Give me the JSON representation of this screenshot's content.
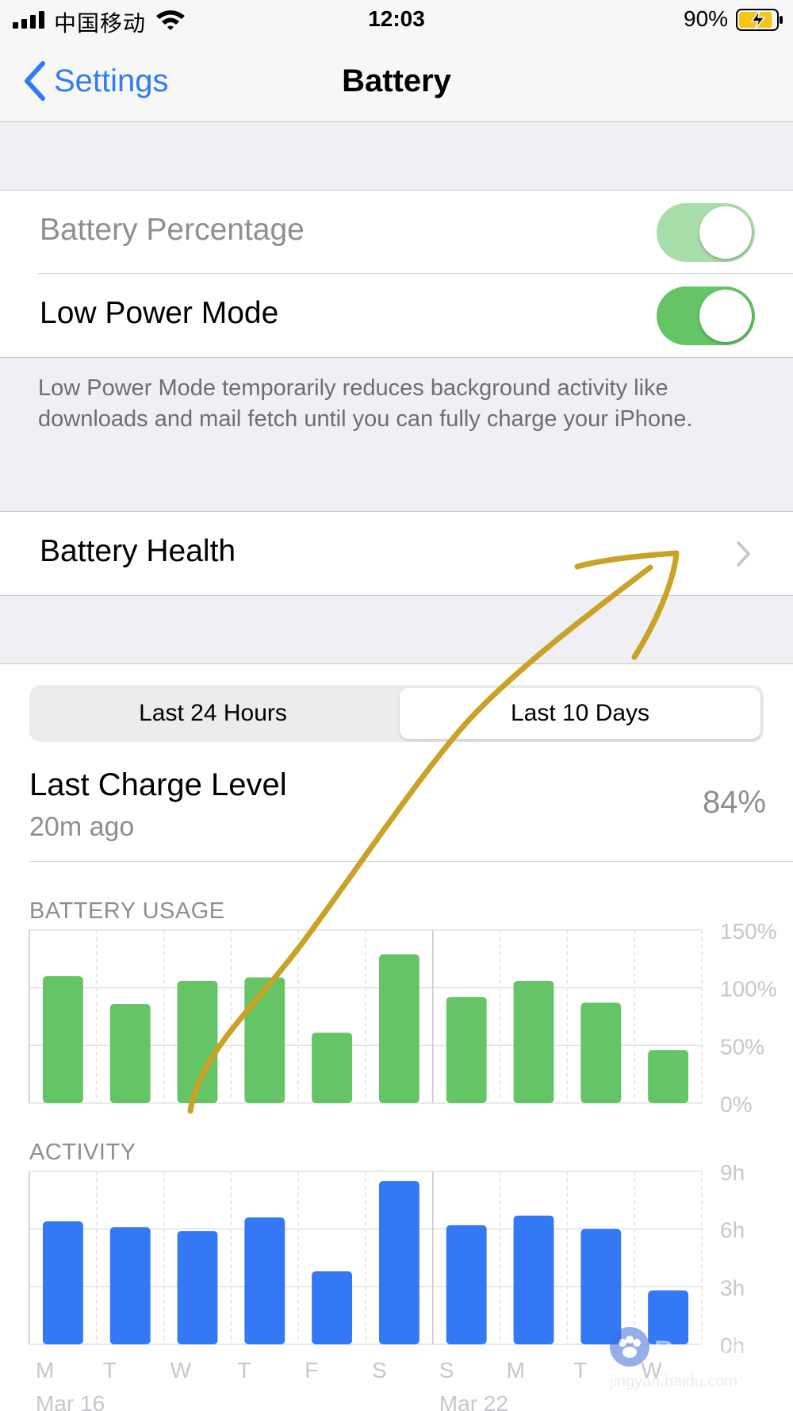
{
  "status_bar": {
    "carrier": "中国移动",
    "time": "12:03",
    "battery_percent": "90%",
    "battery_level": 0.9,
    "charging": true
  },
  "nav": {
    "back_label": "Settings",
    "title": "Battery"
  },
  "settings": {
    "battery_percentage_label": "Battery Percentage",
    "battery_percentage_on": true,
    "battery_percentage_enabled": false,
    "low_power_label": "Low Power Mode",
    "low_power_on": true,
    "low_power_note": "Low Power Mode temporarily reduces background activity like downloads and mail fetch until you can fully charge your iPhone.",
    "battery_health_label": "Battery Health"
  },
  "usage": {
    "tabs": [
      "Last 24 Hours",
      "Last 10 Days"
    ],
    "selected_tab": "Last 10 Days",
    "last_charge_title": "Last Charge Level",
    "last_charge_time": "20m ago",
    "last_charge_value": "84%"
  },
  "colors": {
    "accent": "#2f7cf6",
    "toggle_on": "#65c466",
    "usage_bar": "#65c466",
    "activity_bar": "#3478f6",
    "annotation": "#c9a227"
  },
  "icons": [
    "signal-icon",
    "wifi-icon",
    "battery-charging-icon",
    "back-chevron-icon",
    "chevron-right-icon"
  ],
  "chart_data": [
    {
      "type": "bar",
      "title": "BATTERY USAGE",
      "categories": [
        "M",
        "T",
        "W",
        "T",
        "F",
        "S",
        "S",
        "M",
        "T",
        "W"
      ],
      "date_labels": [
        "Mar 16",
        "Mar 22"
      ],
      "values": [
        110,
        86,
        106,
        109,
        61,
        129,
        92,
        106,
        87,
        46
      ],
      "y_ticks": [
        "150%",
        "100%",
        "50%",
        "0%"
      ],
      "ylim": [
        0,
        150
      ],
      "grid": true
    },
    {
      "type": "bar",
      "title": "ACTIVITY",
      "categories": [
        "M",
        "T",
        "W",
        "T",
        "F",
        "S",
        "S",
        "M",
        "T",
        "W"
      ],
      "date_labels": [
        "Mar 16",
        "Mar 22"
      ],
      "values": [
        6.4,
        6.1,
        5.9,
        6.6,
        3.8,
        8.5,
        6.2,
        6.7,
        6.0,
        2.8
      ],
      "y_ticks": [
        "9h",
        "6h",
        "3h",
        "0h"
      ],
      "ylim": [
        0,
        9
      ],
      "grid": true
    }
  ],
  "watermark": {
    "brand": "Baidu经验",
    "site": "jingyan.baidu.com"
  }
}
